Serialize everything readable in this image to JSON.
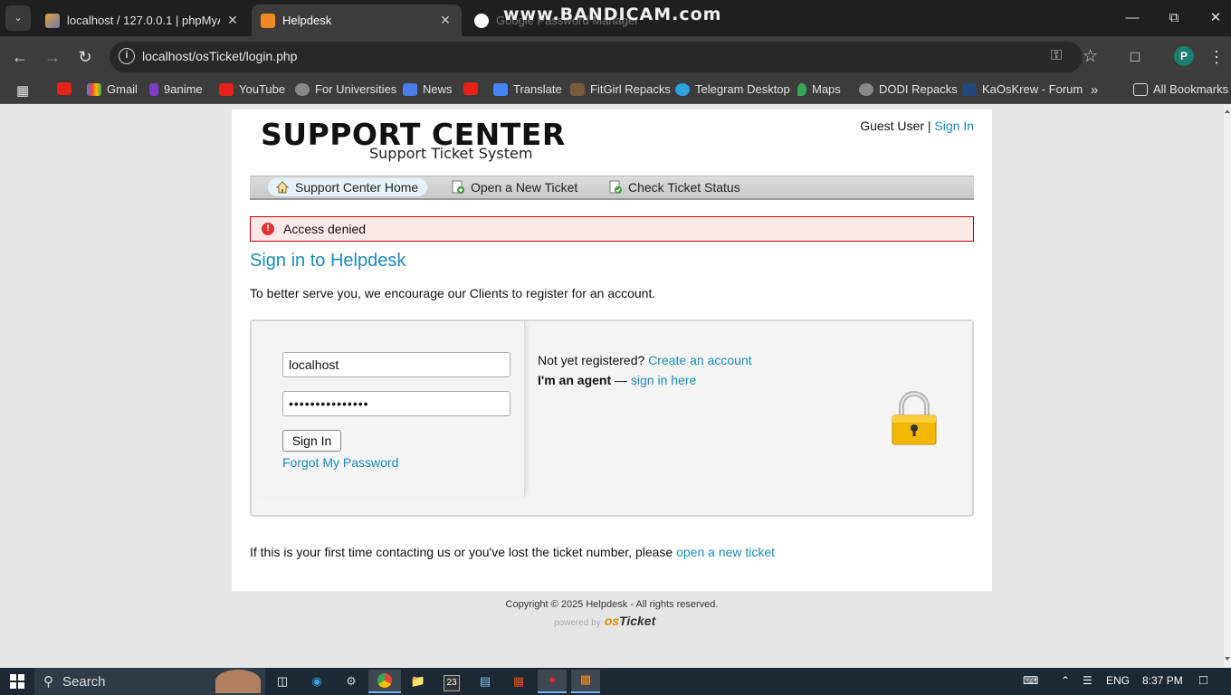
{
  "browser": {
    "tabs": [
      {
        "label": "localhost / 127.0.0.1 | phpMyAd",
        "active": false
      },
      {
        "label": "Helpdesk",
        "active": true
      },
      {
        "label": "Google Password Manager",
        "active": false
      }
    ],
    "watermark": "www.BANDICAM.com",
    "url": "localhost/osTicket/login.php",
    "profile_initial": "P",
    "bookmarks": [
      {
        "label": "",
        "icon": "youtube-icon"
      },
      {
        "label": "Gmail",
        "icon": "gmail-icon"
      },
      {
        "label": "9anime",
        "icon": "9anime-icon"
      },
      {
        "label": "YouTube",
        "icon": "youtube-icon"
      },
      {
        "label": "For Universities",
        "icon": "globe-icon"
      },
      {
        "label": "News",
        "icon": "news-icon"
      },
      {
        "label": "",
        "icon": "youtube-icon"
      },
      {
        "label": "Translate",
        "icon": "translate-icon"
      },
      {
        "label": "FitGirl Repacks",
        "icon": "fitgirl-icon"
      },
      {
        "label": "Telegram Desktop",
        "icon": "telegram-icon"
      },
      {
        "label": "Maps",
        "icon": "maps-icon"
      },
      {
        "label": "DODI Repacks",
        "icon": "globe-icon"
      },
      {
        "label": "KaOsKrew - Forum",
        "icon": "kaoskrew-icon"
      }
    ],
    "all_bookmarks": "All Bookmarks"
  },
  "header": {
    "logo_main": "SUPPORT CENTER",
    "logo_sub": "Support Ticket System",
    "guest_label": "Guest User |",
    "sign_in_link": "Sign In"
  },
  "nav": [
    {
      "label": "Support Center Home",
      "icon": "home-icon",
      "active": true
    },
    {
      "label": "Open a New Ticket",
      "icon": "new-ticket-icon",
      "active": false
    },
    {
      "label": "Check Ticket Status",
      "icon": "ticket-status-icon",
      "active": false
    }
  ],
  "error": {
    "message": "Access denied"
  },
  "main": {
    "title": "Sign in to Helpdesk",
    "intro": "To better serve you, we encourage our Clients to register for an account.",
    "login": {
      "username_value": "localhost",
      "password_value": "•••••••••••••••",
      "sign_in_button": "Sign In",
      "forgot_link": "Forgot My Password",
      "not_registered_text": "Not yet registered?",
      "create_account_link": "Create an account",
      "agent_text": "I'm an agent",
      "agent_sep": " — ",
      "agent_link": "sign in here"
    },
    "footnote_text": "If this is your first time contacting us or you've lost the ticket number, please ",
    "footnote_link": "open a new ticket"
  },
  "footer": {
    "copyright": "Copyright © 2025 Helpdesk - All rights reserved.",
    "powered_by": "powered by",
    "brand_os": "os",
    "brand_ticket": "Ticket"
  },
  "taskbar": {
    "search_label": "Search",
    "lang": "ENG",
    "time": "8:37 PM"
  }
}
